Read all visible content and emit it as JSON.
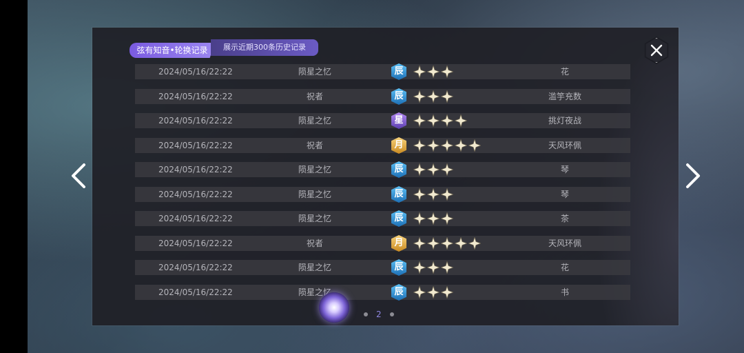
{
  "header": {
    "title": "弦有知音•轮换记录",
    "subtitle": "展示近期300条历史记录"
  },
  "colors": {
    "title_bg": "#7a5be0",
    "badge_3star": "#2a8fd8",
    "badge_4star": "#8a64e0",
    "badge_5star": "#e0a83a",
    "star_fill": "#f2ead0"
  },
  "records": [
    {
      "time": "2024/05/16/22:22",
      "source": "陨星之忆",
      "badge": "辰",
      "stars": 3,
      "item": "花"
    },
    {
      "time": "2024/05/16/22:22",
      "source": "祝者",
      "badge": "辰",
      "stars": 3,
      "item": "滥竽充数"
    },
    {
      "time": "2024/05/16/22:22",
      "source": "陨星之忆",
      "badge": "星",
      "stars": 4,
      "item": "挑灯夜战"
    },
    {
      "time": "2024/05/16/22:22",
      "source": "祝者",
      "badge": "月",
      "stars": 5,
      "item": "天风环佩"
    },
    {
      "time": "2024/05/16/22:22",
      "source": "陨星之忆",
      "badge": "辰",
      "stars": 3,
      "item": "琴"
    },
    {
      "time": "2024/05/16/22:22",
      "source": "陨星之忆",
      "badge": "辰",
      "stars": 3,
      "item": "琴"
    },
    {
      "time": "2024/05/16/22:22",
      "source": "陨星之忆",
      "badge": "辰",
      "stars": 3,
      "item": "茶"
    },
    {
      "time": "2024/05/16/22:22",
      "source": "祝者",
      "badge": "月",
      "stars": 5,
      "item": "天风环佩"
    },
    {
      "time": "2024/05/16/22:22",
      "source": "陨星之忆",
      "badge": "辰",
      "stars": 3,
      "item": "花"
    },
    {
      "time": "2024/05/16/22:22",
      "source": "陨星之忆",
      "badge": "辰",
      "stars": 3,
      "item": "书"
    }
  ],
  "pagination": {
    "current_page": "2"
  },
  "icons": {
    "close": "close-x-icon",
    "prev": "chevron-left-icon",
    "next": "chevron-right-icon",
    "star": "star-icon",
    "orb": "sparkle-orb-icon"
  }
}
